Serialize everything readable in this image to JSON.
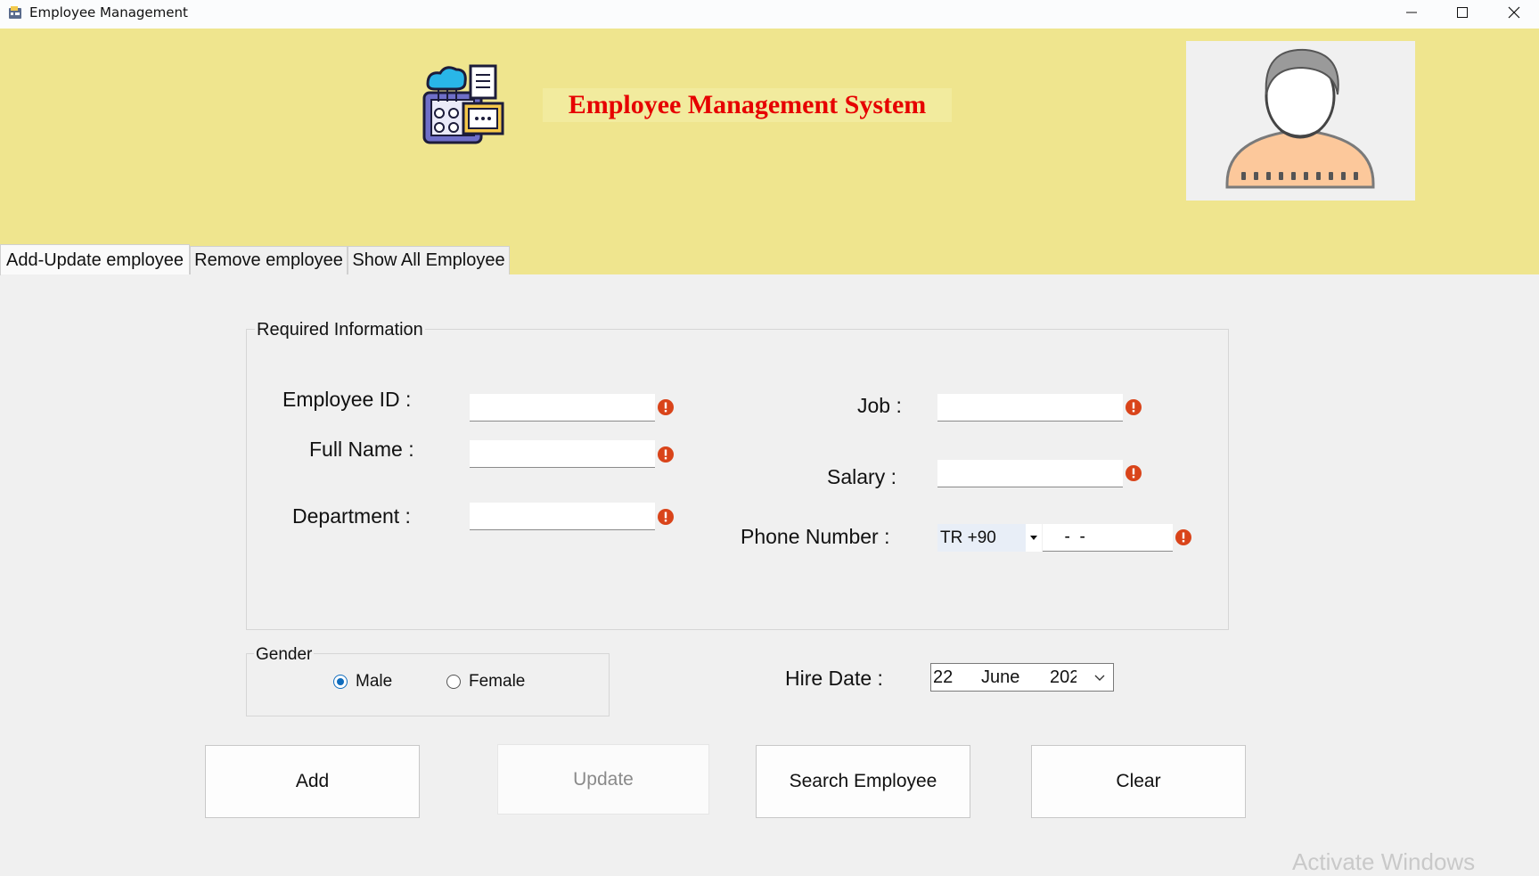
{
  "window": {
    "title": "Employee Management",
    "controls": [
      "minimize-icon",
      "maximize-icon",
      "close-icon"
    ]
  },
  "header": {
    "system_title": "Employee Management System",
    "logo_icon": "employee-database-icon",
    "avatar_icon": "user-avatar-icon"
  },
  "tabs": [
    {
      "label": "Add-Update employee",
      "active": true
    },
    {
      "label": "Remove employee",
      "active": false
    },
    {
      "label": "Show All Employee",
      "active": false
    }
  ],
  "required_info": {
    "legend": "Required Information",
    "employee_id": {
      "label": "Employee ID :",
      "value": ""
    },
    "full_name": {
      "label": "Full Name :",
      "value": ""
    },
    "department": {
      "label": "Department :",
      "value": ""
    },
    "job": {
      "label": "Job :",
      "value": ""
    },
    "salary": {
      "label": "Salary :",
      "value": ""
    },
    "phone": {
      "label": "Phone Number :",
      "country_code": "TR +90",
      "value": "  -  -"
    }
  },
  "gender": {
    "legend": "Gender",
    "options": [
      {
        "label": "Male",
        "checked": true
      },
      {
        "label": "Female",
        "checked": false
      }
    ]
  },
  "hire_date": {
    "label": "Hire Date :",
    "day": "22",
    "month": "June",
    "year": "202"
  },
  "buttons": {
    "add": "Add",
    "update": "Update",
    "search": "Search Employee",
    "clear": "Clear"
  },
  "watermark": "Activate Windows",
  "colors": {
    "banner": "#efe58e",
    "title_red": "#e60000",
    "error_icon": "#d9441a",
    "radio_accent": "#0f6cbd"
  }
}
